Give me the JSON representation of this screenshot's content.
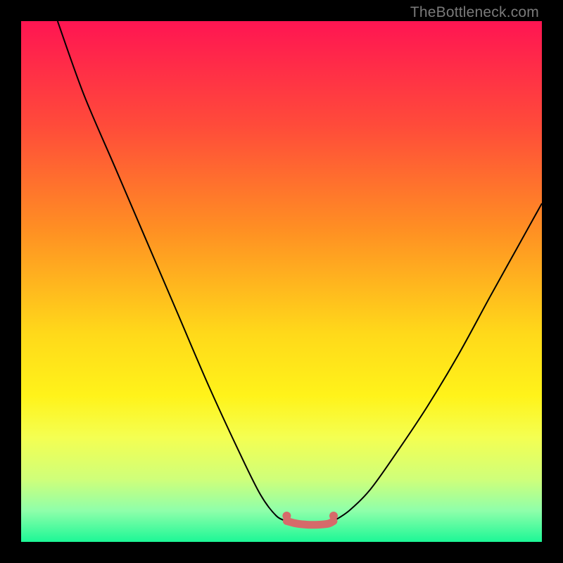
{
  "watermark": "TheBottleneck.com",
  "colors": {
    "frame": "#000000",
    "curve": "#000000",
    "marker": "#d66a6a",
    "gradient_stops": [
      {
        "offset": 0.0,
        "color": "#ff1552"
      },
      {
        "offset": 0.2,
        "color": "#ff4b3a"
      },
      {
        "offset": 0.4,
        "color": "#ff8f23"
      },
      {
        "offset": 0.6,
        "color": "#ffd91a"
      },
      {
        "offset": 0.72,
        "color": "#fff31a"
      },
      {
        "offset": 0.8,
        "color": "#f4ff52"
      },
      {
        "offset": 0.88,
        "color": "#cfff7a"
      },
      {
        "offset": 0.94,
        "color": "#8fffaa"
      },
      {
        "offset": 1.0,
        "color": "#1cf796"
      }
    ]
  },
  "chart_data": {
    "type": "line",
    "title": "",
    "xlabel": "",
    "ylabel": "",
    "xlim": [
      0,
      100
    ],
    "ylim": [
      0,
      100
    ],
    "grid": false,
    "series": [
      {
        "name": "left-curve",
        "x": [
          7,
          12,
          18,
          24,
          30,
          36,
          42,
          46,
          49,
          51
        ],
        "values": [
          100,
          86,
          72,
          58,
          44,
          30,
          17,
          9,
          5,
          4
        ]
      },
      {
        "name": "right-curve",
        "x": [
          60,
          63,
          67,
          72,
          78,
          84,
          90,
          95,
          100
        ],
        "values": [
          4,
          6,
          10,
          17,
          26,
          36,
          47,
          56,
          65
        ]
      },
      {
        "name": "optimal-band",
        "x": [
          51,
          53,
          55,
          57,
          59,
          60
        ],
        "values": [
          4,
          3.5,
          3.3,
          3.3,
          3.5,
          4
        ]
      }
    ],
    "annotations": [
      {
        "type": "marker_dot",
        "x": 51,
        "y": 5
      },
      {
        "type": "marker_dot",
        "x": 60,
        "y": 5
      }
    ]
  }
}
